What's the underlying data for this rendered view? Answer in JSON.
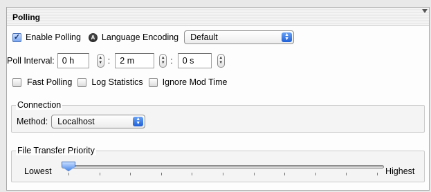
{
  "panel": {
    "title": "Polling"
  },
  "row1": {
    "enable_polling_label": "Enable Polling",
    "enable_polling_checked": true,
    "language_encoding_label": "Language Encoding",
    "encoding_value": "Default"
  },
  "poll_interval": {
    "label": "Poll Interval:",
    "hours": "0 h",
    "minutes": "2 m",
    "seconds": "0 s",
    "separator": ":"
  },
  "options": {
    "fast_polling": "Fast Polling",
    "log_statistics": "Log Statistics",
    "ignore_mod_time": "Ignore Mod Time"
  },
  "connection": {
    "title": "Connection",
    "method_label": "Method:",
    "method_value": "Localhost"
  },
  "transfer": {
    "title": "File Transfer Priority",
    "low_label": "Lowest",
    "high_label": "Highest",
    "value_fraction": 0,
    "tick_count": 11
  },
  "colors": {
    "accent": "#1f5fd6"
  }
}
